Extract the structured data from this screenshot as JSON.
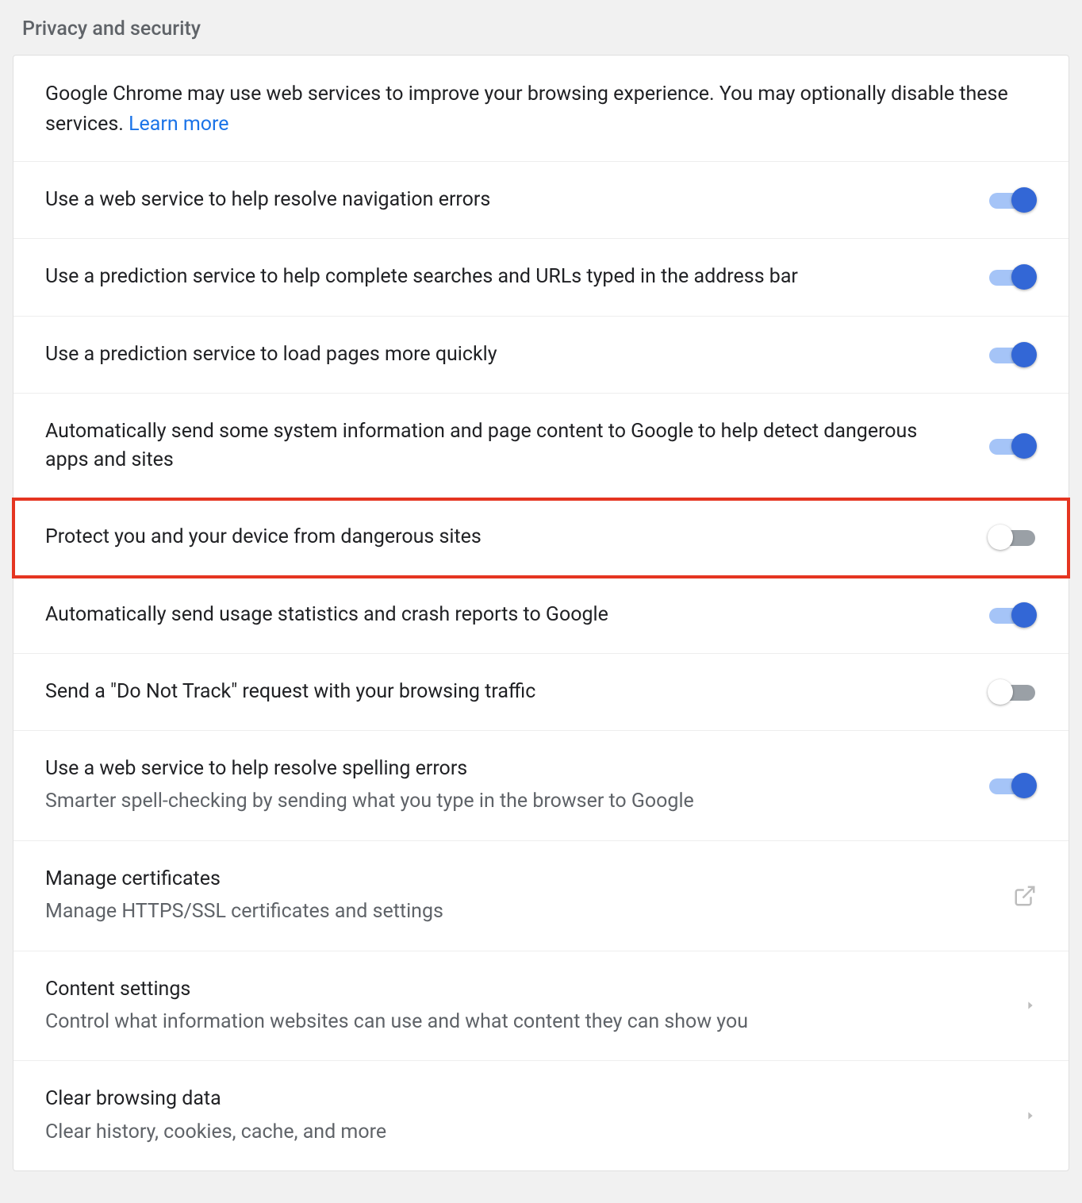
{
  "section_title": "Privacy and security",
  "intro_text": "Google Chrome may use web services to improve your browsing experience. You may optionally disable these services. ",
  "intro_link": "Learn more",
  "rows": [
    {
      "title": "Use a web service to help resolve navigation errors",
      "subtitle": "",
      "type": "toggle",
      "on": true,
      "highlight": false
    },
    {
      "title": "Use a prediction service to help complete searches and URLs typed in the address bar",
      "subtitle": "",
      "type": "toggle",
      "on": true,
      "highlight": false
    },
    {
      "title": "Use a prediction service to load pages more quickly",
      "subtitle": "",
      "type": "toggle",
      "on": true,
      "highlight": false
    },
    {
      "title": "Automatically send some system information and page content to Google to help detect dangerous apps and sites",
      "subtitle": "",
      "type": "toggle",
      "on": true,
      "highlight": false
    },
    {
      "title": "Protect you and your device from dangerous sites",
      "subtitle": "",
      "type": "toggle",
      "on": false,
      "highlight": true
    },
    {
      "title": "Automatically send usage statistics and crash reports to Google",
      "subtitle": "",
      "type": "toggle",
      "on": true,
      "highlight": false
    },
    {
      "title": "Send a \"Do Not Track\" request with your browsing traffic",
      "subtitle": "",
      "type": "toggle",
      "on": false,
      "highlight": false
    },
    {
      "title": "Use a web service to help resolve spelling errors",
      "subtitle": "Smarter spell-checking by sending what you type in the browser to Google",
      "type": "toggle",
      "on": true,
      "highlight": false
    },
    {
      "title": "Manage certificates",
      "subtitle": "Manage HTTPS/SSL certificates and settings",
      "type": "external",
      "on": false,
      "highlight": false
    },
    {
      "title": "Content settings",
      "subtitle": "Control what information websites can use and what content they can show you",
      "type": "chevron",
      "on": false,
      "highlight": false
    },
    {
      "title": "Clear browsing data",
      "subtitle": "Clear history, cookies, cache, and more",
      "type": "chevron",
      "on": false,
      "highlight": false
    }
  ]
}
